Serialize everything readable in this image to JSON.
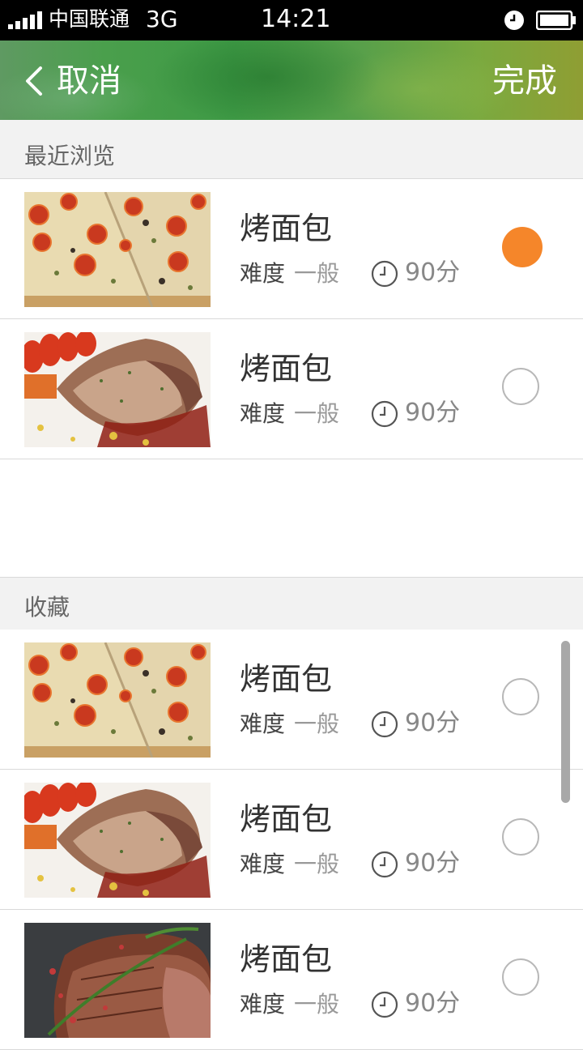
{
  "status_bar": {
    "carrier": "中国联通",
    "network": "3G",
    "time": "14:21"
  },
  "header": {
    "back_label": "取消",
    "done_label": "完成"
  },
  "sections": {
    "recent": {
      "title": "最近浏览",
      "items": [
        {
          "title": "烤面包",
          "difficulty_label": "难度",
          "difficulty_value": "一般",
          "time": "90分",
          "image": "pizza-tomato",
          "selected": true
        },
        {
          "title": "烤面包",
          "difficulty_label": "难度",
          "difficulty_value": "一般",
          "time": "90分",
          "image": "roast-meat",
          "selected": false
        }
      ]
    },
    "favorites": {
      "title": "收藏",
      "items": [
        {
          "title": "烤面包",
          "difficulty_label": "难度",
          "difficulty_value": "一般",
          "time": "90分",
          "image": "pizza-tomato",
          "selected": false
        },
        {
          "title": "烤面包",
          "difficulty_label": "难度",
          "difficulty_value": "一般",
          "time": "90分",
          "image": "roast-meat",
          "selected": false
        },
        {
          "title": "烤面包",
          "difficulty_label": "难度",
          "difficulty_value": "一般",
          "time": "90分",
          "image": "grilled-steak",
          "selected": false
        }
      ]
    }
  },
  "colors": {
    "accent": "#f5862a",
    "header_green": "#3e9a45",
    "section_bg": "#f2f2f2"
  }
}
